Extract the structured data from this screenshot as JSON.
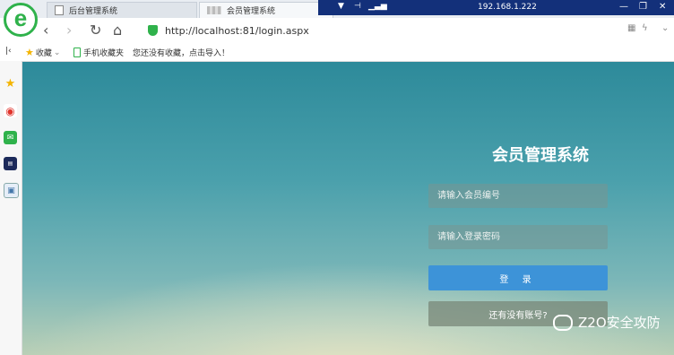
{
  "tabs": [
    {
      "label": "后台管理系统"
    },
    {
      "label": "会员管理系统"
    }
  ],
  "remote": {
    "ip": "192.168.1.222"
  },
  "address": {
    "url": "http://localhost:81/login.aspx"
  },
  "bookmarks": {
    "favorites": "收藏",
    "mobile": "手机收藏夹",
    "hint": "您还没有收藏，点击导入！"
  },
  "login": {
    "title": "会员管理系统",
    "member_placeholder": "请输入会员编号",
    "password_placeholder": "请输入登录密码",
    "login_button": "登 录",
    "register_button": "还有没有账号?"
  },
  "watermark": "Z2O安全攻防",
  "colors": {
    "brand_green": "#2fb24b",
    "login_blue": "#3d93d8",
    "remote_bar": "#13307a"
  }
}
